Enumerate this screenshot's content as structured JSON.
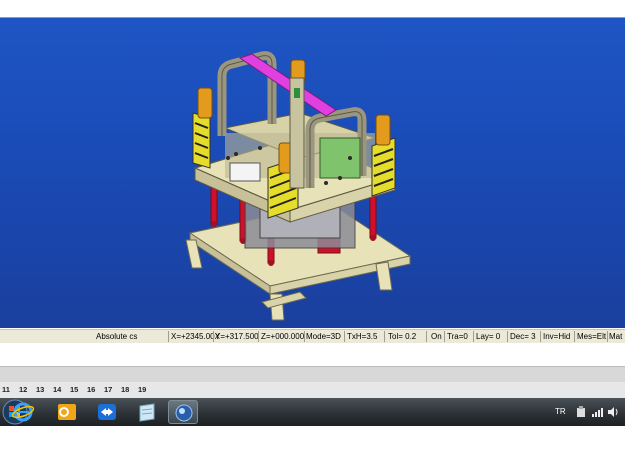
{
  "statusbar": {
    "coord_system": "Absolute cs",
    "x": "X=+2345.00X",
    "y": "Y=+317.500",
    "z": "Z=+000.000",
    "mode": "Mode=3D",
    "txh": "TxH=3.5",
    "tol": "Tol=   0.2",
    "on": "On",
    "tra": "Tra=0",
    "lay": "Lay=  0",
    "dec": "Dec=  3",
    "inv": "Inv=Hid",
    "mes": "Mes=Elt",
    "mat": "Mat"
  },
  "pages": [
    "11",
    "12",
    "13",
    "14",
    "15",
    "16",
    "17",
    "18",
    "19"
  ],
  "taskbar": {
    "apps": [
      "internet-explorer",
      "outlook",
      "teamviewer",
      "notes",
      "cad-app"
    ],
    "tray_lang": "TR"
  },
  "colors": {
    "viewport_bg": "#1e55c4",
    "frame_beige": "#e8e2b8",
    "column_red": "#d0102a",
    "magenta_arm": "#e040e0",
    "orange_caps": "#e39b1e",
    "hazard_yellow": "#e6dd2a"
  }
}
